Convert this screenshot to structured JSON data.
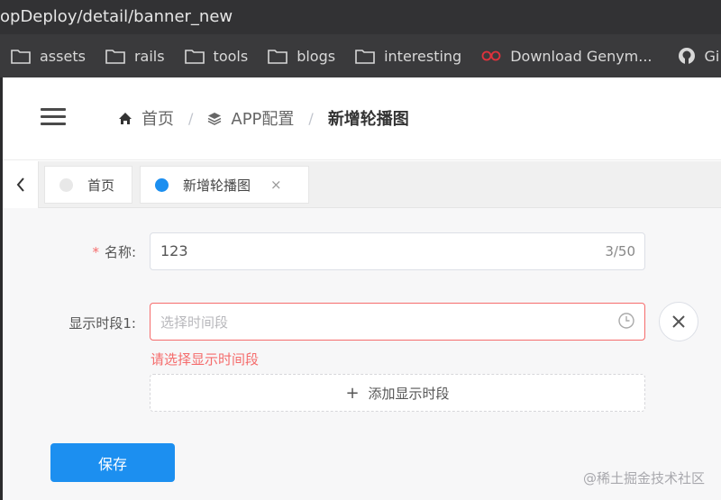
{
  "browser": {
    "url": "opDeploy/detail/banner_new",
    "bookmarks": [
      {
        "label": "assets",
        "icon": "folder-icon"
      },
      {
        "label": "rails",
        "icon": "folder-icon"
      },
      {
        "label": "tools",
        "icon": "folder-icon"
      },
      {
        "label": "blogs",
        "icon": "folder-icon"
      },
      {
        "label": "interesting",
        "icon": "folder-icon"
      },
      {
        "label": "Download Genym...",
        "icon": "genymotion-icon"
      },
      {
        "label": "Gi",
        "icon": "github-icon"
      }
    ]
  },
  "breadcrumb": {
    "home": "首页",
    "config": "APP配置",
    "current": "新增轮播图"
  },
  "tabs": [
    {
      "label": "首页",
      "active": false
    },
    {
      "label": "新增轮播图",
      "active": true,
      "close": "×"
    }
  ],
  "form": {
    "name_label": "名称:",
    "name_required_mark": "*",
    "name_value": "123",
    "name_count": "3/50",
    "period_label": "显示时段1:",
    "period_placeholder": "选择时间段",
    "period_error": "请选择显示时间段",
    "add_period_label": "添加显示时段",
    "add_icon": "+",
    "save_label": "保存"
  },
  "watermark": "@稀土掘金技术社区",
  "colors": {
    "primary": "#1c8ff0",
    "error": "#f56c6c",
    "inactive_dot": "#e8e8e8"
  }
}
